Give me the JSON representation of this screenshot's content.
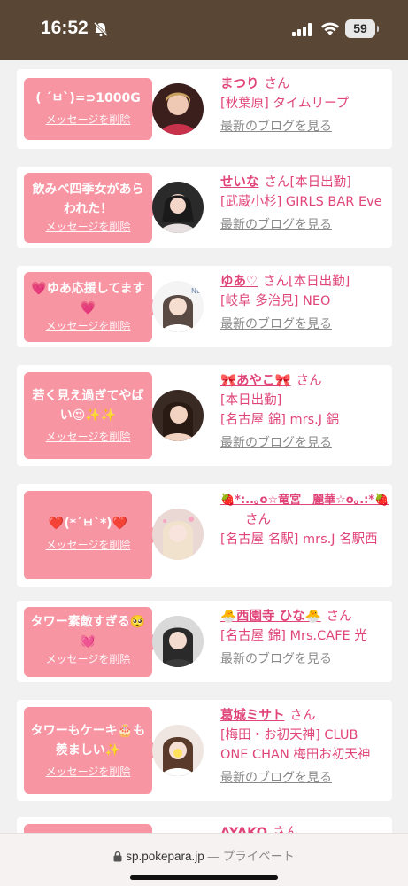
{
  "status": {
    "time": "16:52",
    "battery": "59",
    "bell_icon": "bell-slash-icon",
    "signal_icon": "signal-icon",
    "wifi_icon": "wifi-icon"
  },
  "delete_label": "メッセージを削除",
  "blog_label": "最新のブログを見る",
  "san": "さん",
  "colors": {
    "accent": "#e0457a",
    "bubble": "#f895a3",
    "status_bar": "#5a4634"
  },
  "cards": [
    {
      "message": "( ´ㅂ`)=⊃1000G",
      "name": "まつり",
      "lines": [
        "[秋葉原] タイムリープ"
      ]
    },
    {
      "message": "飲みべ四季女があらわれた！",
      "name": "せいな",
      "san_suffix": "[本日出勤]",
      "lines": [
        "[武蔵小杉] GIRLS BAR Eve"
      ]
    },
    {
      "message": "💗ゆあ応援してます💗",
      "name": "ゆあ♡",
      "san_suffix": "[本日出勤]",
      "lines": [
        "[岐阜 多治見] NEO"
      ]
    },
    {
      "message": "若く見え過ぎてやばい😍✨✨",
      "name": "🎀あやこ🎀",
      "lines": [
        "[本日出勤]",
        "[名古屋 錦] mrs.J 錦"
      ]
    },
    {
      "message": "❤️(*´ㅂ`*)❤️",
      "name": "🍓*:..｡o☆竜宮　麗華☆o｡.:*🍓",
      "lines": [
        "[名古屋 名駅] mrs.J 名駅西"
      ]
    },
    {
      "message": "タワー素敵すぎる🥺💓",
      "name": "🐣西園寺 ひな🐣",
      "lines": [
        "[名古屋 錦] Mrs.CAFE 光"
      ]
    },
    {
      "message": "タワーもケーキ🎂も羨ましい✨",
      "name": "葛城ミサト",
      "lines": [
        "[梅田・お初天神] CLUB",
        "ONE CHAN 梅田お初天神"
      ]
    },
    {
      "name": "AYAKO"
    }
  ],
  "browser": {
    "url": "sp.pokepara.jp",
    "separator": " — ",
    "mode": "プライベート"
  }
}
